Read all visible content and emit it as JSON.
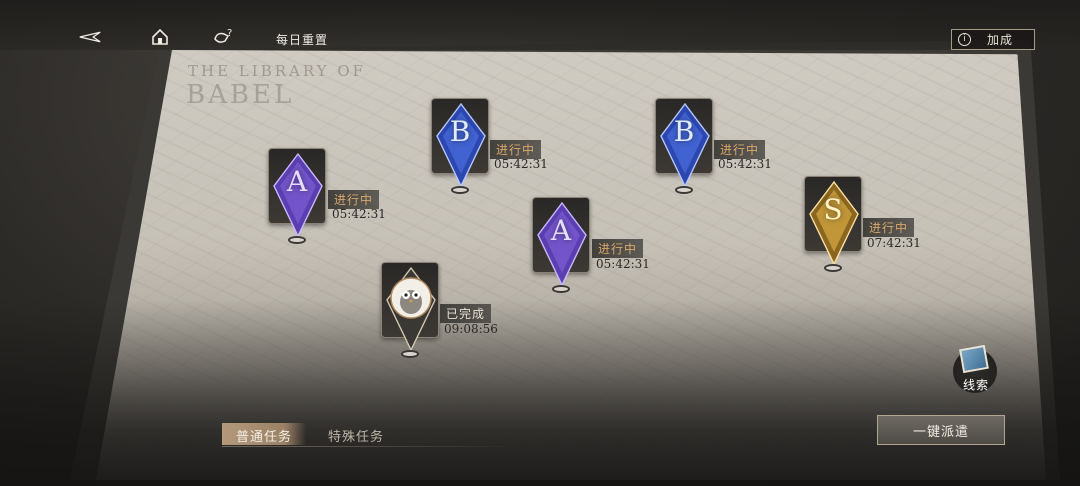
{
  "topbar": {
    "back_icon": "back-arrow-icon",
    "home_icon": "home-icon",
    "help_icon": "help-icon",
    "reset_label": "每日重置",
    "bonus_label": "加成",
    "bonus_info_glyph": "i"
  },
  "map": {
    "title_line1": "THE LIBRARY OF",
    "title_line2": "BABEL"
  },
  "missions": [
    {
      "grade": "A",
      "status": "进行中",
      "time": "05:42:31",
      "color": "#8d6ad8"
    },
    {
      "grade": "B",
      "status": "进行中",
      "time": "05:42:31",
      "color": "#4f6fd9"
    },
    {
      "grade": "B",
      "status": "进行中",
      "time": "05:42:31",
      "color": "#4f6fd9"
    },
    {
      "grade": "A",
      "status": "进行中",
      "time": "05:42:31",
      "color": "#8d6ad8"
    },
    {
      "grade": "S",
      "status": "进行中",
      "time": "07:42:31",
      "color": "#d7a84a"
    },
    {
      "grade": "",
      "status": "已完成",
      "time": "09:08:56",
      "color": "#c6b7a0",
      "icon": "owl-avatar-icon"
    }
  ],
  "clues": {
    "label": "线索",
    "icon": "photo-clue-icon"
  },
  "tabs": {
    "normal": "普通任务",
    "special": "特殊任务"
  },
  "dispatch_label": "一键派遣",
  "colors": {
    "in_progress": "#d9a86a",
    "accent": "#b49a7b"
  }
}
